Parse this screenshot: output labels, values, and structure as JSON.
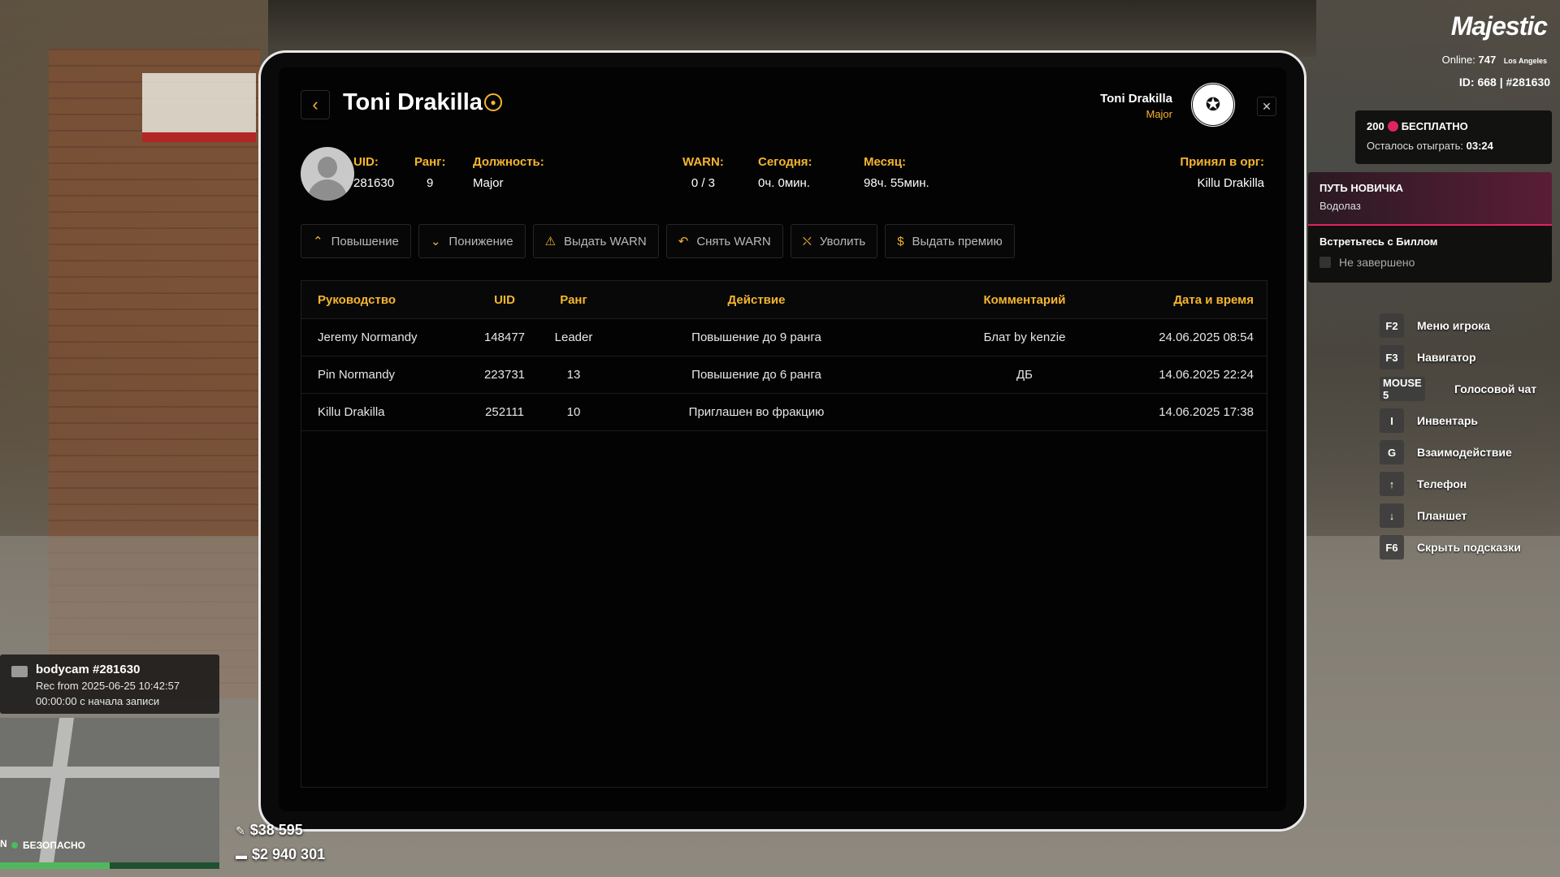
{
  "hud": {
    "logo": "Majestic",
    "online_label": "Online:",
    "online_count": "747",
    "city": "Los Angeles",
    "id_line": "ID: 668 | #281630",
    "bonus": {
      "amount": "200",
      "label": "БЕСПЛАТНО",
      "remaining_label": "Осталось отыграть:",
      "remaining_time": "03:24"
    },
    "quest": {
      "title": "ПУТЬ НОВИЧКА",
      "subtitle": "Водолаз",
      "task": "Встретьтесь с Биллом",
      "status": "Не завершено"
    },
    "keys": [
      {
        "key": "F2",
        "label": "Меню игрока"
      },
      {
        "key": "F3",
        "label": "Навигатор"
      },
      {
        "key": "MOUSE 5",
        "label": "Голосовой чат"
      },
      {
        "key": "I",
        "label": "Инвентарь"
      },
      {
        "key": "G",
        "label": "Взаимодействие"
      },
      {
        "key": "↑",
        "label": "Телефон"
      },
      {
        "key": "↓",
        "label": "Планшет"
      },
      {
        "key": "F6",
        "label": "Скрыть подсказки"
      }
    ],
    "bodycam": {
      "title": "bodycam #281630",
      "rec": "Rec from 2025-06-25 10:42:57",
      "elapsed": "00:00:00 с начала записи"
    },
    "safe_zone": "БЕЗОПАСНО",
    "compass": "N",
    "cash": "$38 595",
    "bank": "$2 940 301"
  },
  "tablet": {
    "title": "Toni Drakilla",
    "header_user": {
      "name": "Toni Drakilla",
      "rank": "Major"
    },
    "info": {
      "uid_label": "UID:",
      "uid": "281630",
      "rank_label": "Ранг:",
      "rank": "9",
      "position_label": "Должность:",
      "position": "Major",
      "warn_label": "WARN:",
      "warn": "0 / 3",
      "today_label": "Сегодня:",
      "today": "0ч. 0мин.",
      "month_label": "Месяц:",
      "month": "98ч. 55мин.",
      "accepted_label": "Принял в орг:",
      "accepted": "Killu Drakilla"
    },
    "actions": [
      {
        "label": "Повышение",
        "icon": "chevron-up-icon",
        "glyph": "⌃"
      },
      {
        "label": "Понижение",
        "icon": "chevron-down-icon",
        "glyph": "⌄"
      },
      {
        "label": "Выдать WARN",
        "icon": "warn-doc-icon",
        "glyph": "⚠"
      },
      {
        "label": "Снять WARN",
        "icon": "undo-icon",
        "glyph": "↶"
      },
      {
        "label": "Уволить",
        "icon": "fire-person-icon",
        "glyph": "⛌"
      },
      {
        "label": "Выдать премию",
        "icon": "coin-icon",
        "glyph": "$"
      }
    ],
    "table": {
      "headers": [
        "Руководство",
        "UID",
        "Ранг",
        "Действие",
        "Комментарий",
        "Дата и время"
      ],
      "rows": [
        [
          "Jeremy Normandy",
          "148477",
          "Leader",
          "Повышение до 9 ранга",
          "Блат by kenzie",
          "24.06.2025 08:54"
        ],
        [
          "Pin Normandy",
          "223731",
          "13",
          "Повышение до 6 ранга",
          "ДБ",
          "14.06.2025 22:24"
        ],
        [
          "Killu Drakilla",
          "252111",
          "10",
          "Приглашен во фракцию",
          "",
          "14.06.2025 17:38"
        ]
      ]
    }
  },
  "colors": {
    "accent": "#f5b52e",
    "quest_accent": "#e0245e",
    "safe": "#4cbb5c"
  }
}
